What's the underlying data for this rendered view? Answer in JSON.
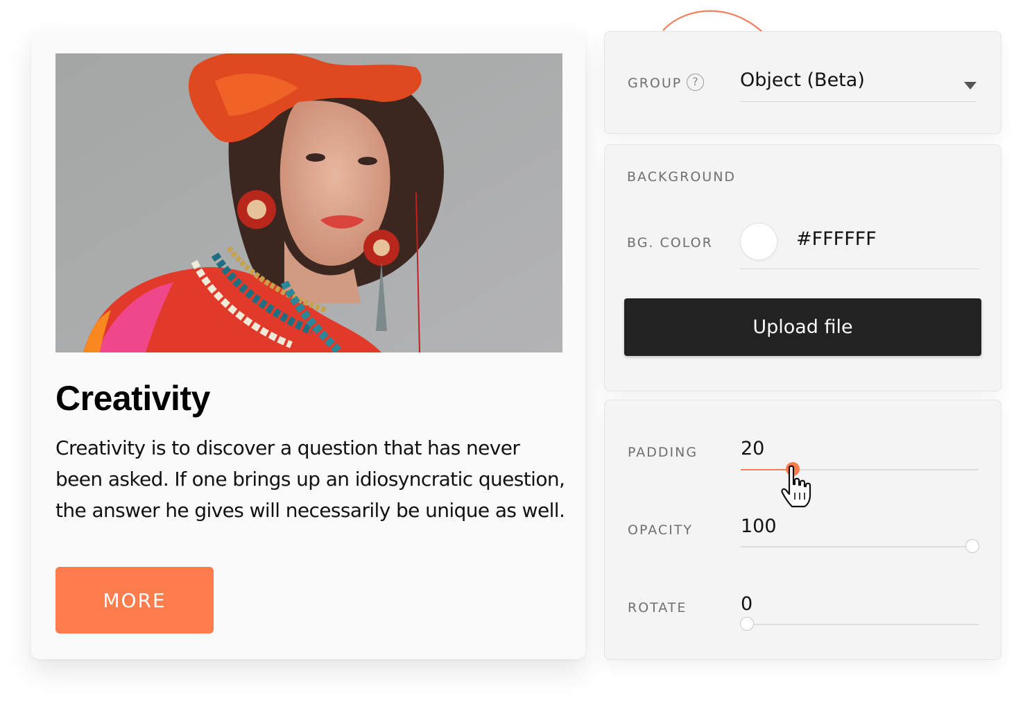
{
  "card": {
    "title": "Creativity",
    "body": "Creativity is to discover a question that has never been asked. If one brings up an idiosyncratic question, the answer he gives will necessarily be unique as well.",
    "button_label": "MORE",
    "accent_color": "#ff7c4d"
  },
  "group": {
    "label": "GROUP",
    "help_icon": "?",
    "selected": "Object (Beta)"
  },
  "background": {
    "section_label": "BACKGROUND",
    "color_label": "BG. COLOR",
    "color_value": "#FFFFFF",
    "upload_label": "Upload file"
  },
  "transform": {
    "padding": {
      "label": "PADDING",
      "value": "20",
      "fraction": 0.22
    },
    "opacity": {
      "label": "OPACITY",
      "value": "100",
      "fraction": 1.0
    },
    "rotate": {
      "label": "ROTATE",
      "value": "0",
      "fraction": 0.0
    }
  },
  "icons": [
    "help-icon",
    "chevron-down-icon",
    "hand-pointer-icon",
    "curved-arrow-icon"
  ]
}
